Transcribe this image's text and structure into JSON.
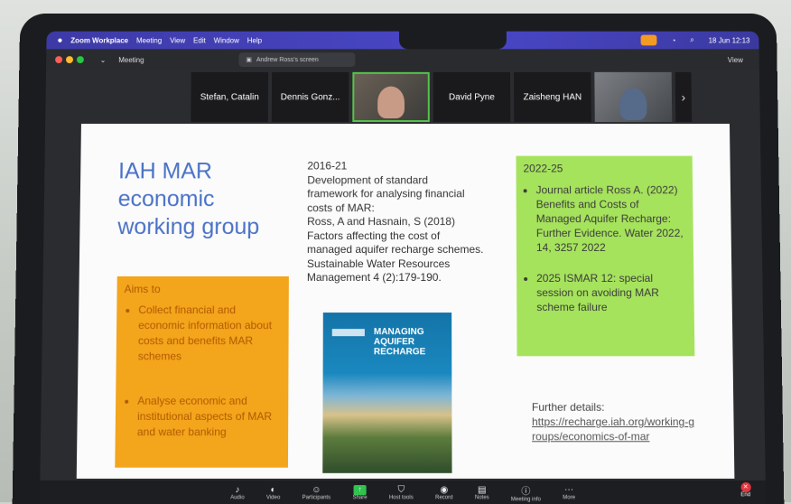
{
  "menubar": {
    "app": "Zoom Workplace",
    "items": [
      "Meeting",
      "View",
      "Edit",
      "Window",
      "Help"
    ],
    "clock": "18 Jun 12:13"
  },
  "zoom": {
    "window_label": "Meeting",
    "share_label": "Andrew Ross's screen",
    "view_label": "View"
  },
  "gallery": {
    "participants": [
      "Stefan, Catalin",
      "Dennis Gonz...",
      "",
      "David Pyne",
      "Zaisheng HAN",
      ""
    ],
    "next": "›"
  },
  "slide": {
    "title_lines": [
      "IAH MAR",
      "economic",
      "working group"
    ],
    "aims_heading": "Aims to",
    "aims": [
      "Collect financial and economic information about costs and benefits MAR schemes",
      "Analyse economic and institutional aspects of MAR and water banking"
    ],
    "mid_lines": [
      "2016-21",
      "Development of standard",
      "framework  for analysing financial",
      "costs of MAR:",
      "Ross, A and Hasnain, S (2018)",
      "Factors affecting the cost of",
      "managed aquifer recharge schemes.",
      "Sustainable Water Resources",
      "Management 4 (2):179-190."
    ],
    "book_title": "MANAGING AQUIFER RECHARGE",
    "book_logo": "UNESCO",
    "green_heading": "2022-25",
    "green_items": [
      "Journal article Ross A. (2022) Benefits and Costs of Managed Aquifer Recharge: Further Evidence. Water 2022, 14, 3257 2022",
      "2025 ISMAR 12: special session on avoiding MAR scheme failure"
    ],
    "further_label": "Further details:",
    "further_link": "https://recharge.iah.org/working-groups/economics-of-mar"
  },
  "toolbar": {
    "items": [
      "Audio",
      "Video",
      "Participants",
      "Share",
      "Host tools",
      "Record",
      "Notes",
      "Meeting info",
      "More"
    ],
    "end": "End"
  },
  "colors": {
    "title_blue": "#4a72c7",
    "aims_orange": "#f3a51c",
    "green_box": "#a6e35d",
    "zoom_purple": "#4a47c8"
  }
}
